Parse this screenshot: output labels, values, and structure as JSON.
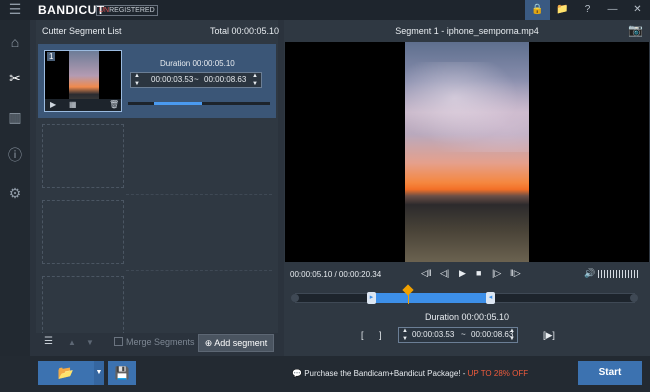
{
  "app": {
    "logo_a": "BANDI",
    "logo_b": "CUT",
    "reg_prefix": "UN",
    "reg_suffix": "REGISTERED"
  },
  "titlebar": {
    "lock": "🔒",
    "folder": "📁",
    "help": "?",
    "min": "—",
    "close": "✕"
  },
  "sidebar": {
    "menu": "☰",
    "home": "⌂",
    "cutter": "✂",
    "join": "▥",
    "info": "ⓘ",
    "settings": "⚙",
    "record": "◉"
  },
  "left": {
    "header": "Cutter Segment List",
    "total": "Total 00:00:05.10",
    "segment": {
      "number": "1",
      "duration": "Duration 00:00:05.10",
      "start": "00:00:03.53",
      "tilde": "~",
      "end": "00:00:08.63",
      "progress_fraction": 0.4
    },
    "footer": {
      "merge": "Merge Segments",
      "add": "Add segment",
      "add_icon": "⊕",
      "list_icon": "☰",
      "up": "▲",
      "down": "▼"
    }
  },
  "player": {
    "title": "Segment 1 - iphone_semporna.mp4",
    "camera": "📷",
    "time": "00:00:05.10 / 00:00:20.34",
    "controls": [
      "◁‖",
      "◁|",
      "▶",
      "■",
      "|▷",
      "‖▷"
    ],
    "volume_icon": "🔊",
    "duration": "Duration 00:00:05.10",
    "start": "00:00:03.53",
    "tilde": "~",
    "end": "00:00:08.63",
    "mark_in": "[",
    "mark_out": "]",
    "play_sel": "[▶]"
  },
  "bottom": {
    "open_icon": "📂",
    "dd": "▼",
    "save_icon": "💾",
    "promo_icon": "💬",
    "promo": "Purchase the Bandicam+Bandicut Package! - ",
    "promo_offer": "UP TO 28% OFF",
    "start": "Start"
  },
  "colors": {
    "accent": "#3c72b0",
    "selection": "#3d8fe8",
    "playhead": "#f0a000",
    "offer": "#ef5b3c"
  }
}
